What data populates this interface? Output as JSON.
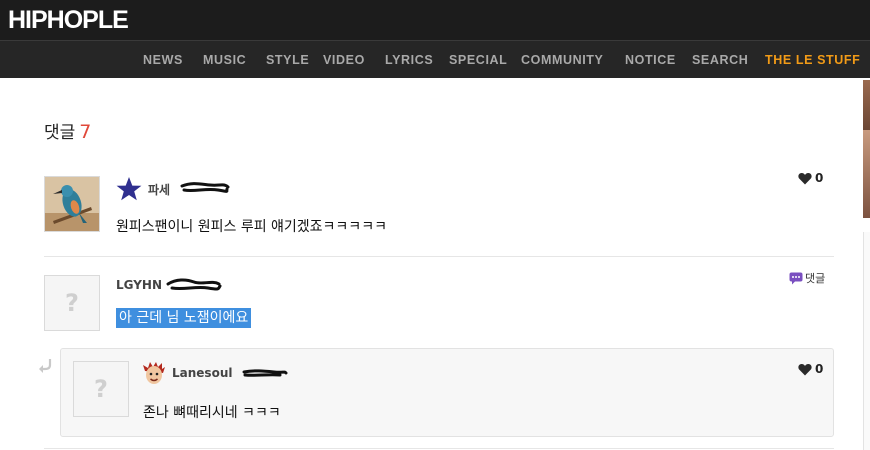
{
  "site": {
    "logo": "HIPHOPLE"
  },
  "nav": {
    "items": [
      {
        "label": "NEWS"
      },
      {
        "label": "MUSIC"
      },
      {
        "label": "STYLE"
      },
      {
        "label": "VIDEO"
      },
      {
        "label": "LYRICS"
      },
      {
        "label": "SPECIAL"
      },
      {
        "label": "COMMUNITY"
      },
      {
        "label": "NOTICE"
      },
      {
        "label": "SEARCH"
      },
      {
        "label": "THE LE STUFF"
      }
    ],
    "accent_color": "#f29b17"
  },
  "comments_header": {
    "title": "댓글",
    "count": "7"
  },
  "comments": [
    {
      "username": "파세",
      "text": "원피스팬이니 원피스 루피 얘기겠죠ㅋㅋㅋㅋㅋ",
      "likes": "0",
      "rank_icon": "star-icon",
      "avatar": "kingfisher-bird-photo"
    },
    {
      "username": "LGYHN",
      "text": "아 근데 님 노잼이에요",
      "reply_label": "댓글",
      "avatar": "question-mark-placeholder"
    }
  ],
  "reply": {
    "username": "Lanesoul",
    "text": "존나 뼈때리시네 ㅋㅋㅋ",
    "likes": "0",
    "avatar": "question-mark-placeholder",
    "level_icon": "cartoon-face-icon"
  },
  "placeholder_glyph": "?",
  "colors": {
    "header_bg": "#1c1c1c",
    "nav_bg": "#262626",
    "selection": "#3f8fdf",
    "count_red": "#e0483a",
    "reply_badge": "#7a4fc0"
  }
}
